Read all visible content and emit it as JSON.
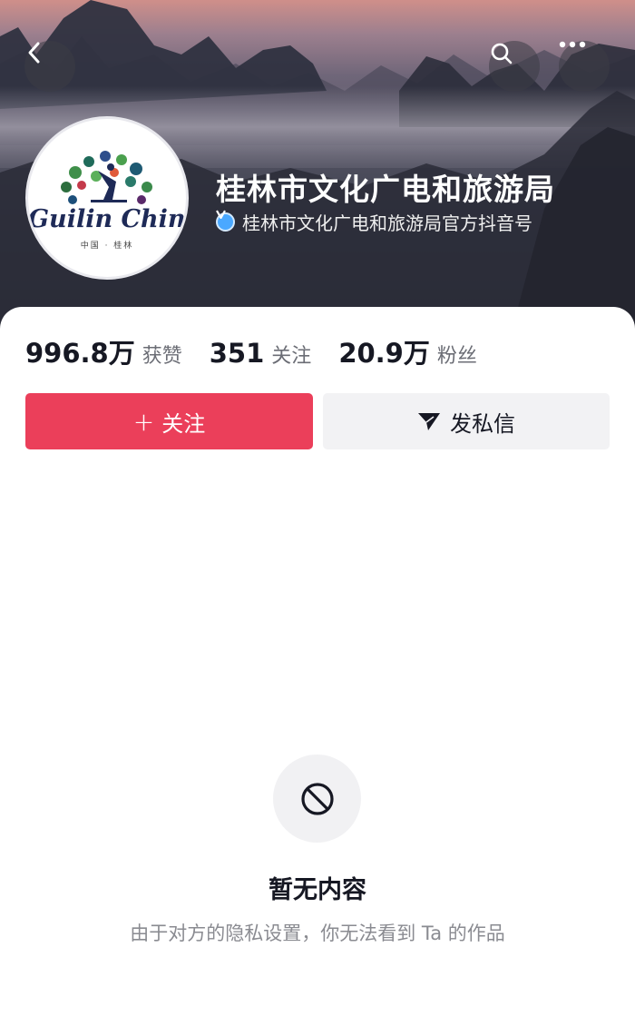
{
  "header": {
    "back_icon": "chevron-left-icon",
    "search_icon": "search-icon",
    "more_icon": "more-dots-icon"
  },
  "profile": {
    "avatar_logo_text": "Guilin China",
    "avatar_sub_text": "中国 · 桂林",
    "name": "桂林市文化广电和旅游局",
    "verified_icon": "verified-v-icon",
    "verified_text": "桂林市文化广电和旅游局官方抖音号"
  },
  "stats": [
    {
      "value": "996.8万",
      "label": "获赞"
    },
    {
      "value": "351",
      "label": "关注"
    },
    {
      "value": "20.9万",
      "label": "粉丝"
    }
  ],
  "actions": {
    "follow_plus": "+",
    "follow_label": "关注",
    "message_label": "发私信",
    "message_icon": "send-icon"
  },
  "empty_state": {
    "icon": "prohibited-icon",
    "title": "暂无内容",
    "description": "由于对方的隐私设置，你无法看到 Ta 的作品"
  },
  "colors": {
    "follow_button": "#eb3f5a",
    "message_button": "#f2f2f4",
    "verified_badge": "#4aa8ff",
    "text_primary": "#161823",
    "text_secondary": "#8a8b91"
  }
}
